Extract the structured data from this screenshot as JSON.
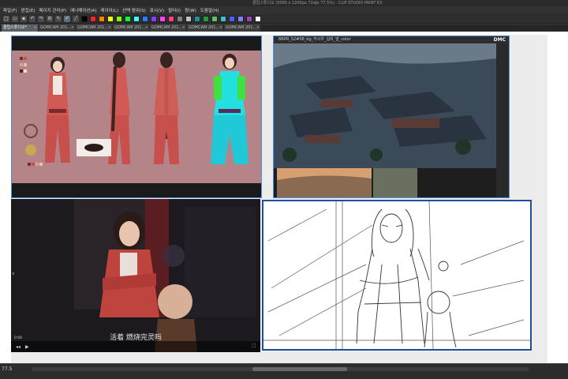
{
  "window": {
    "title": "클립스튜디오 (3000 x 1200px 72dpi 77.5%) - CLIP STUDIO PAINT EX"
  },
  "menu": {
    "items": [
      "파일(F)",
      "편집(E)",
      "페이지 관리(P)",
      "애니메이션(A)",
      "레이어(L)",
      "선택 범위(S)",
      "표시(V)",
      "필터(I)",
      "창(W)",
      "도움말(H)"
    ]
  },
  "toolbar": {
    "tools": [
      "new-icon",
      "open-icon",
      "save-icon",
      "undo-icon",
      "redo-icon",
      "gear-icon",
      "brush-icon",
      "pen-icon",
      "line-icon"
    ],
    "swatches": [
      "#000000",
      "#ff2020",
      "#ff8000",
      "#ffff00",
      "#80ff00",
      "#00ff40",
      "#40ffff",
      "#2080ff",
      "#8040ff",
      "#ff40ff",
      "#ff4080",
      "#808080",
      "#c0c0c0",
      "#2090a0",
      "#20a040",
      "#60c060",
      "#40c0c0",
      "#4060ff",
      "#8080ff",
      "#a040c0",
      "#ffffff"
    ]
  },
  "tabs": [
    {
      "label": "클립스튜디오*",
      "active": true
    },
    {
      "label": "GOMCAM 201...",
      "active": false
    },
    {
      "label": "GOMCAM 201...",
      "active": false
    },
    {
      "label": "GOMCAM 201...",
      "active": false
    },
    {
      "label": "GOMCAM 201...",
      "active": false
    },
    {
      "label": "GOMCAM 201...",
      "active": false
    },
    {
      "label": "GOMCAM 201...",
      "active": false
    }
  ],
  "panels": {
    "reference_photo_title": "BRPR_S2#08_bg_카시우_실외_앞_color",
    "reference_logo": "DMC",
    "video_subtitle": "活着 燃烧完灵吗",
    "video_time": "0:00"
  },
  "status": {
    "zoom": "77.5"
  }
}
